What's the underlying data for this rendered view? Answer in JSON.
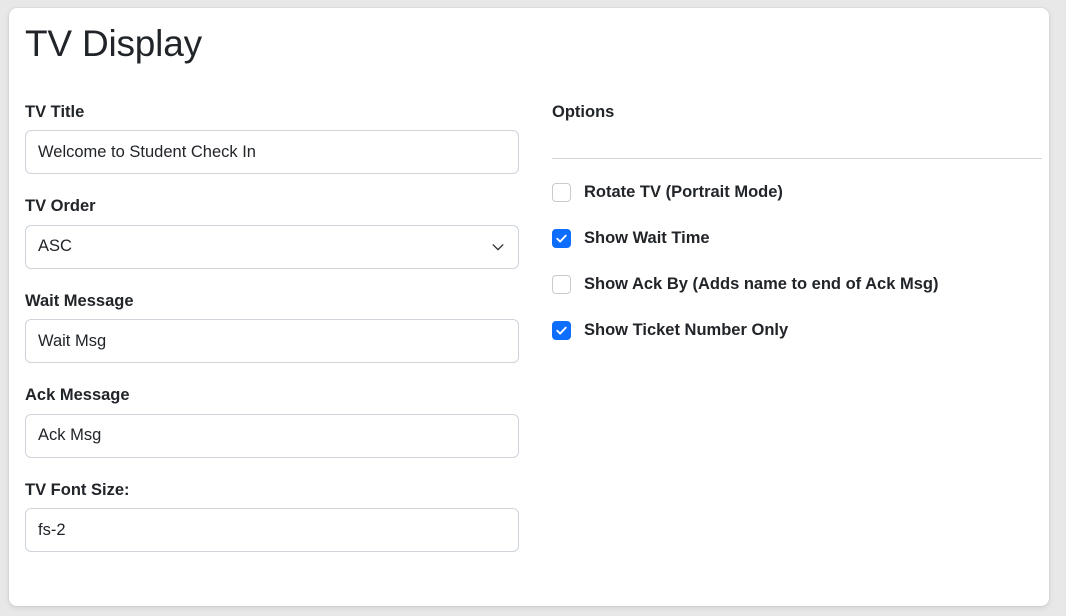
{
  "page": {
    "title": "TV Display"
  },
  "form": {
    "fields": [
      {
        "label": "TV Title",
        "type": "text",
        "value": "Welcome to Student Check In",
        "name": "tv-title"
      },
      {
        "label": "TV Order",
        "type": "select",
        "value": "ASC",
        "name": "tv-order",
        "icon": "chevron-down-icon"
      },
      {
        "label": "Wait Message",
        "type": "text",
        "value": "Wait Msg",
        "name": "wait-message"
      },
      {
        "label": "Ack Message",
        "type": "text",
        "value": "Ack Msg",
        "name": "ack-message"
      },
      {
        "label": "TV Font Size:",
        "type": "text",
        "value": "fs-2",
        "name": "tv-font-size"
      }
    ]
  },
  "options": {
    "heading": "Options",
    "checkboxes": [
      {
        "label": "Rotate TV (Portrait Mode)",
        "checked": false,
        "name": "rotate-tv-portrait-mode"
      },
      {
        "label": "Show Wait Time",
        "checked": true,
        "name": "show-wait-time"
      },
      {
        "label": "Show Ack By (Adds name to end of Ack Msg)",
        "checked": false,
        "name": "show-ack-by"
      },
      {
        "label": "Show Ticket Number Only",
        "checked": true,
        "name": "show-ticket-number-only"
      }
    ]
  },
  "colors": {
    "accent": "#0d6efd",
    "text": "#212529",
    "border": "#ced4da",
    "page_background": "#e8e8e9",
    "card_background": "#ffffff",
    "divider": "#d3d4d6"
  }
}
